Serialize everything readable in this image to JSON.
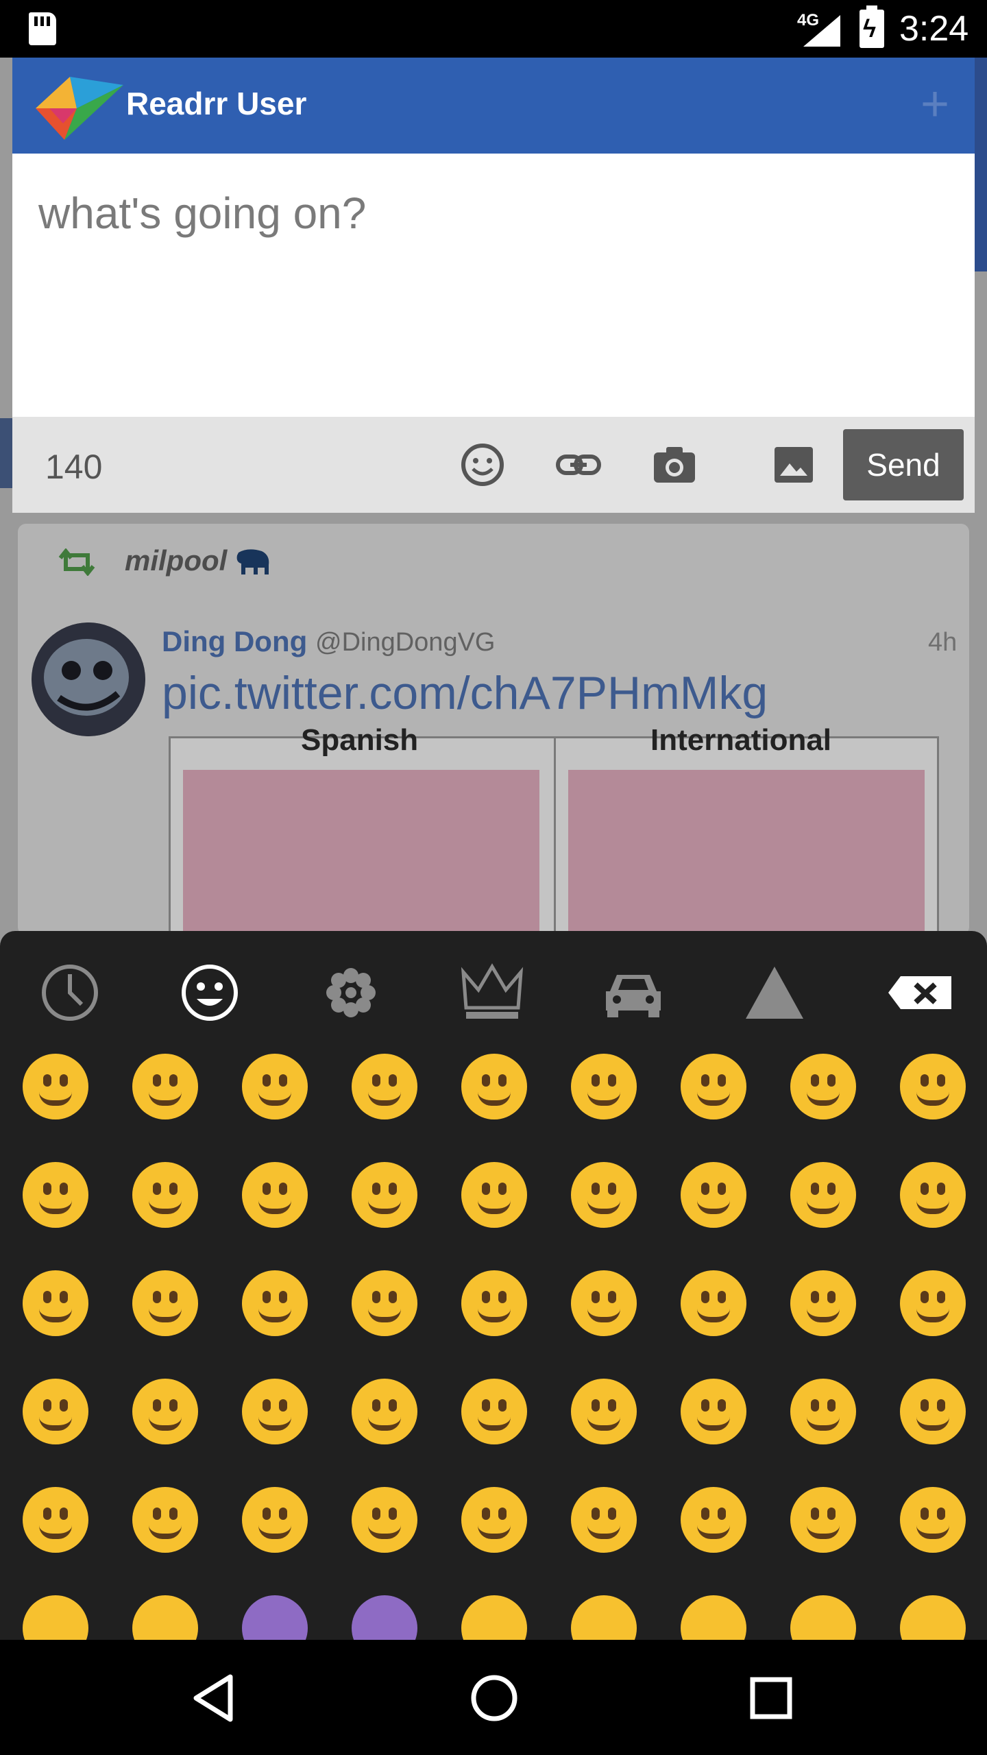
{
  "status_bar": {
    "network": "4G",
    "time": "3:24"
  },
  "composer": {
    "account_name": "Readrr User",
    "placeholder": "what's going on?",
    "char_count": "140",
    "send_label": "Send",
    "toolbar_icons": [
      "emoji-icon",
      "link-icon",
      "camera-icon",
      "image-icon"
    ]
  },
  "timeline": {
    "retweeted_by": "milpool",
    "author_name": "Ding Dong",
    "author_handle": "@DingDongVG",
    "time": "4h",
    "text": "pic.twitter.com/chA7PHmMkg",
    "media_captions": [
      "Spanish",
      "International"
    ]
  },
  "emoji_keyboard": {
    "categories": [
      "recent",
      "smileys",
      "nature",
      "objects",
      "places",
      "symbols"
    ],
    "selected_category": "smileys",
    "rows": [
      [
        "😄",
        "😃",
        "😀",
        "😊",
        "☺",
        "😉",
        "😍",
        "😘",
        "😚"
      ],
      [
        "😗",
        "😙",
        "😜",
        "😝",
        "😛",
        "😳",
        "😁",
        "😔",
        "😌"
      ],
      [
        "😒",
        "😞",
        "😣",
        "😢",
        "😂",
        "😭",
        "😪",
        "😥",
        "😰"
      ],
      [
        "😅",
        "😓",
        "😩",
        "😫",
        "😨",
        "😱",
        "😠",
        "😡",
        "😤"
      ],
      [
        "😖",
        "😆",
        "😋",
        "😷",
        "😎",
        "😴",
        "😵",
        "😲",
        "😟"
      ]
    ]
  },
  "colors": {
    "header_blue": "#2f5fb1",
    "send_button": "#5c5c5c",
    "keyboard_bg": "#202020",
    "link_blue": "#3d5a8e"
  }
}
